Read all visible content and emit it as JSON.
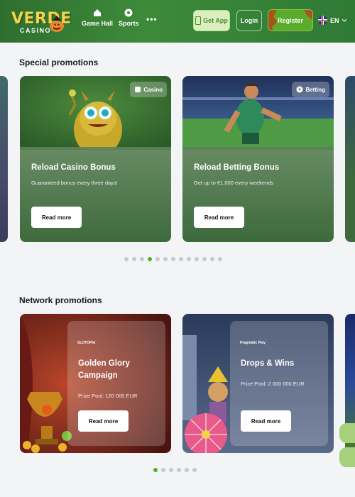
{
  "header": {
    "logo_text": "VERDE",
    "logo_sub": "CASINO",
    "nav": [
      {
        "label": "Game Hall"
      },
      {
        "label": "Sports"
      }
    ],
    "more": "•••",
    "get_app": "Get App",
    "login": "Login",
    "register": "Register",
    "language": "EN"
  },
  "special": {
    "title": "Special promotions",
    "cards": [
      {
        "badge": "Casino",
        "title": "Reload Casino Bonus",
        "desc": "Guaranteed bonus every three days!",
        "button": "Read more"
      },
      {
        "badge": "Betting",
        "title": "Reload Betting Bonus",
        "desc": "Get up to €1,000 every weekends",
        "button": "Read more"
      }
    ],
    "dots_total": 13,
    "dots_active_index": 3
  },
  "network": {
    "title": "Network promotions",
    "cards": [
      {
        "provider": "SLOTOPIA",
        "title": "Golden Glory Campaign",
        "desc": "Prize Pool: 120 000 EUR",
        "button": "Read more"
      },
      {
        "provider": "Pragmatic Play",
        "title": "Drops & Wins",
        "desc": "Prize Pool: 2 000 000 EUR",
        "button": "Read more"
      }
    ],
    "dots_total": 6,
    "dots_active_index": 0
  },
  "colors": {
    "header": "#3d8a3a",
    "accent": "#5aa92f",
    "card_overlay": "#3e6b3d"
  }
}
